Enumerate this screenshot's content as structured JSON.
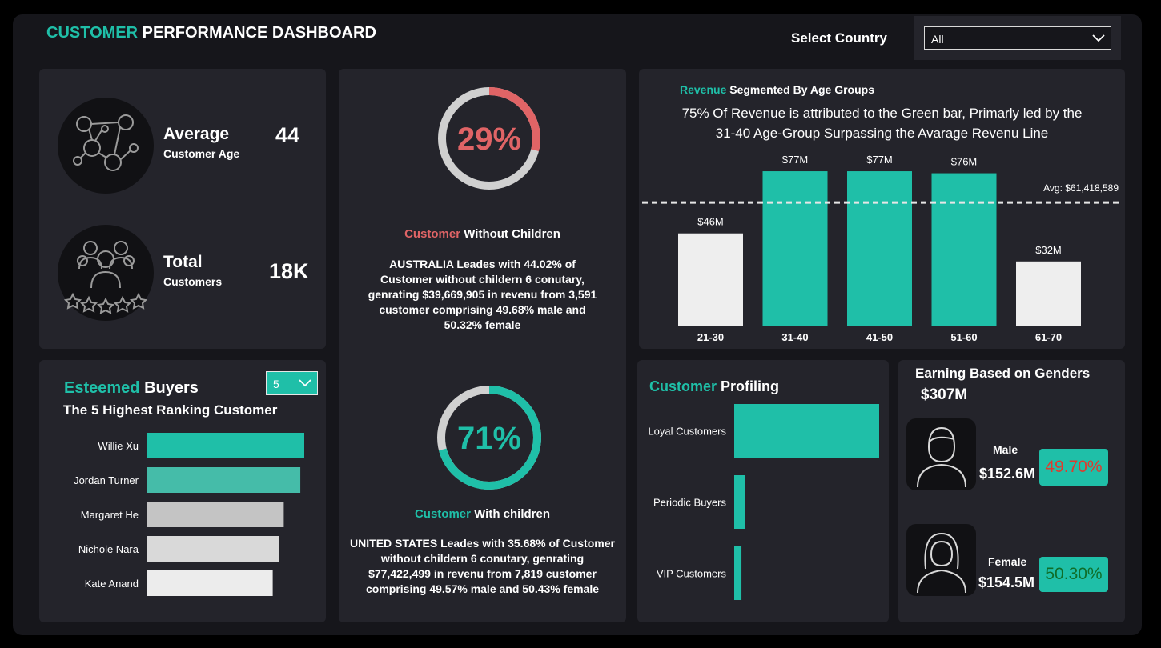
{
  "header": {
    "title_accent": "CUSTOMER",
    "title_rest": "PERFORMANCE DASHBOARD",
    "select_label": "Select Country",
    "country_value": "All"
  },
  "kpis": {
    "avg_age_title": "Average",
    "avg_age_sub": "Customer Age",
    "avg_age_value": "44",
    "total_title": "Total",
    "total_sub": "Customers",
    "total_value": "18K"
  },
  "children": {
    "without_pct": "29%",
    "without_fraction": 0.29,
    "without_title_accent": "Customer",
    "without_title_rest": "Without Children",
    "without_desc": "AUSTRALIA Leades with 44.02% of Customer without childern 6 conutary, genrating $39,669,905 in revenu from 3,591 customer comprising 49.68% male and 50.32% female",
    "with_pct": "71%",
    "with_fraction": 0.71,
    "with_title_accent": "Customer",
    "with_title_rest": "With children",
    "with_desc": "UNITED STATES Leades with 35.68% of Customer without childern 6 conutary, genrating $77,422,499 in revenu from 7,819 customer comprising 49.57% male and 50.43% female"
  },
  "revenue": {
    "title_accent": "Revenue",
    "title_rest": "Segmented By Age Groups",
    "subtitle_line1": "75% Of Revenue is attributed to the Green bar, Primarly led by the",
    "subtitle_line2": "31-40 Age-Group Surpassing the Avarage Revenu Line",
    "avg_label": "Avg: $61,418,589"
  },
  "buyers": {
    "title_accent": "Esteemed",
    "title_rest": "Buyers",
    "subtitle": "The 5 Highest Ranking Customer",
    "top_n": "5"
  },
  "profiling": {
    "title_accent": "Customer",
    "title_rest": "Profiling"
  },
  "gender": {
    "title": "Earning Based on Genders",
    "total": "$307M",
    "male_label": "Male",
    "male_value": "$152.6M",
    "male_pct": "49.70%",
    "female_label": "Female",
    "female_value": "$154.5M",
    "female_pct": "50.30%"
  },
  "colors": {
    "teal": "#1fbfa8",
    "red": "#e06466",
    "light_bar": "#eeeeee",
    "panel": "#24242b",
    "background": "#16161b"
  },
  "chart_data": [
    {
      "type": "bar",
      "title": "Revenue Segmented By Age Groups",
      "categories": [
        "21-30",
        "31-40",
        "41-50",
        "51-60",
        "61-70"
      ],
      "values": [
        46,
        77,
        77,
        76,
        32
      ],
      "data_labels": [
        "$46M",
        "$77M",
        "$77M",
        "$76M",
        "$32M"
      ],
      "highlight": [
        false,
        true,
        true,
        true,
        false
      ],
      "average": 61.418589,
      "ylim": [
        0,
        85
      ],
      "grid": false
    },
    {
      "type": "bar",
      "orientation": "horizontal",
      "title": "The 5 Highest Ranking Customer",
      "categories": [
        "Willie Xu",
        "Jordan Turner",
        "Margaret He",
        "Nichole Nara",
        "Kate Anand"
      ],
      "values": [
        1.0,
        0.975,
        0.87,
        0.84,
        0.8
      ],
      "colors": [
        "#1fbfa8",
        "#45bca9",
        "#c4c4c4",
        "#d9d9d9",
        "#ececec"
      ]
    },
    {
      "type": "bar",
      "orientation": "horizontal",
      "title": "Customer Profiling",
      "categories": [
        "Loyal Customers",
        "Periodic Buyers",
        "VIP Customers"
      ],
      "values": [
        1.0,
        0.075,
        0.05
      ]
    }
  ]
}
